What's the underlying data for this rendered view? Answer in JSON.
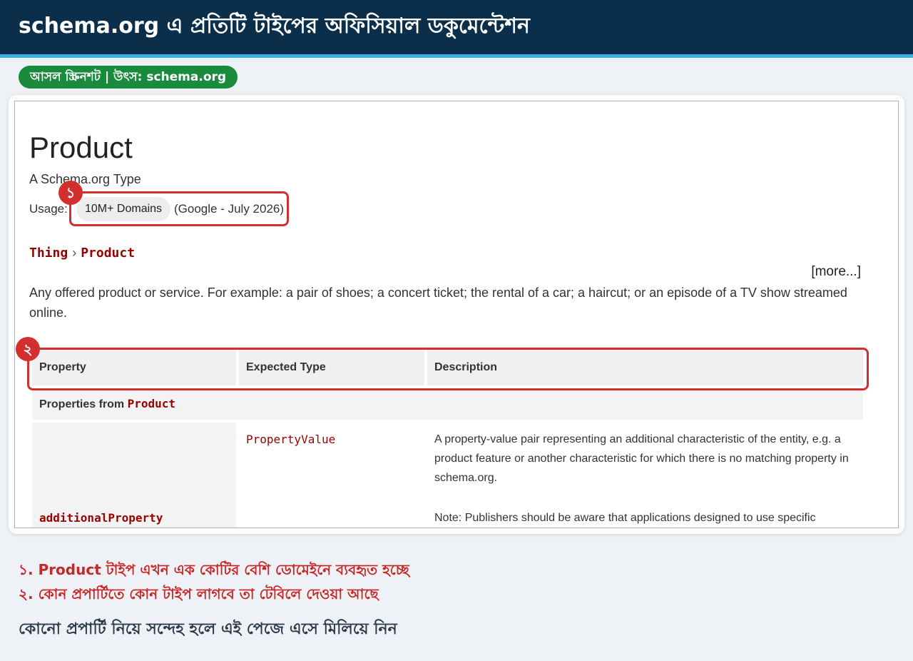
{
  "header": {
    "title": "schema.org এ প্রতিটি টাইপের অফিসিয়াল ডকুমেন্টেশন"
  },
  "source_badge": "আসল স্ক্রিনশট | উৎস: schema.org",
  "screenshot": {
    "page_title": "Product",
    "subtitle": "A Schema.org Type",
    "usage_label": "Usage:",
    "usage_value": "10M+ Domains",
    "usage_source": "(Google - July 2026)",
    "breadcrumb": [
      "Thing",
      "Product"
    ],
    "breadcrumb_separator": "›",
    "more_link": "[more...]",
    "description": "Any offered product or service. For example: a pair of shoes; a concert ticket; the rental of a car; a haircut; or an episode of a TV show streamed online.",
    "table": {
      "headers": [
        "Property",
        "Expected Type",
        "Description"
      ],
      "group_label": "Properties from ",
      "group_type": "Product",
      "rows": [
        {
          "property": "additionalProperty",
          "expected_type": "PropertyValue",
          "description": "A property-value pair representing an additional characteristic of the entity, e.g. a product feature or another characteristic for which there is no matching property in schema.org.",
          "note": "Note: Publishers should be aware that applications designed to use specific"
        }
      ]
    }
  },
  "callouts": [
    {
      "number": "১",
      "note": "১. Product টাইপ এখন এক কোটির বেশি ডোমেইনে ব্যবহৃত হচ্ছে"
    },
    {
      "number": "২",
      "note": "২. কোন প্রপার্টিতে কোন টাইপ লাগবে তা টেবিলে দেওয়া আছে"
    }
  ],
  "footer": "কোনো প্রপার্টি নিয়ে সন্দেহ হলে এই পেজে এসে মিলিয়ে নিন",
  "colors": {
    "header_bg": "#0b2e4a",
    "accent_line": "#3aaee0",
    "badge_green": "#1a8a3c",
    "highlight_red": "#d32f2f",
    "schema_link": "#990000"
  }
}
